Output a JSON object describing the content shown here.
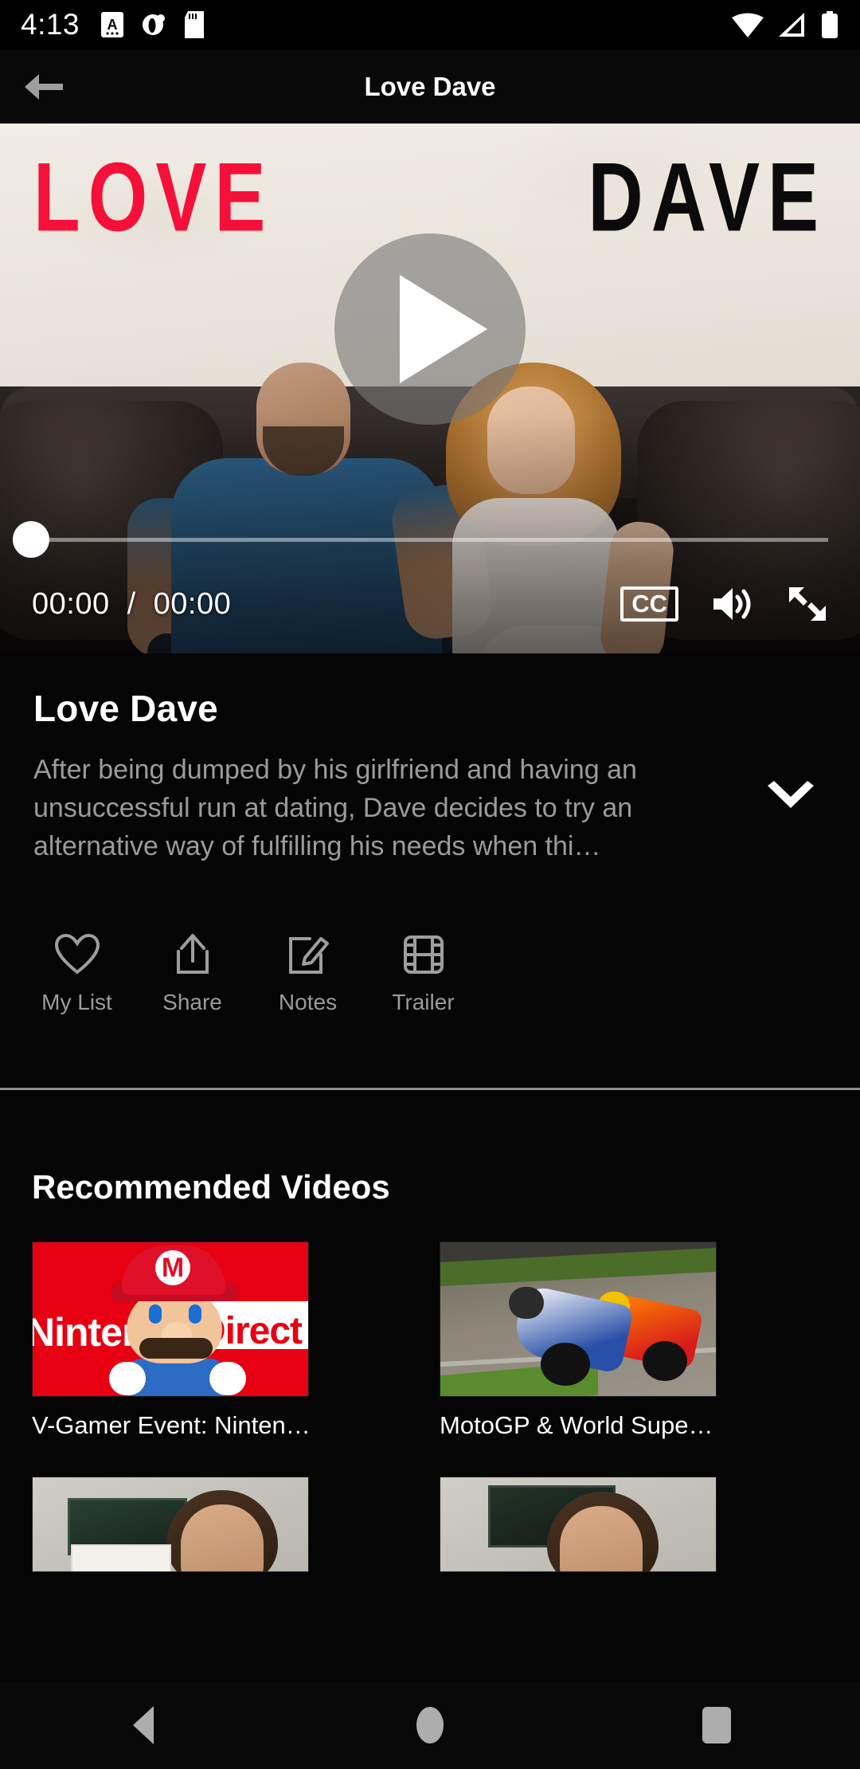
{
  "status_bar": {
    "time": "4:13",
    "left_icons": [
      "screenshot-a-icon",
      "app-badge-icon",
      "sd-card-icon"
    ],
    "right_icons": [
      "wifi-icon",
      "cellular-signal-icon",
      "battery-icon"
    ]
  },
  "app_bar": {
    "back_icon": "arrow-left-icon",
    "title": "Love Dave"
  },
  "player": {
    "poster_text_left": "LOVE",
    "poster_text_right": "DAVE",
    "poster_color_left": "#F5103A",
    "poster_color_right": "#0B0B0B",
    "poster_bg": "#EDE8E0",
    "play_icon": "play-icon",
    "current_time": "00:00",
    "time_separator": "/",
    "total_time": "00:00",
    "progress_percent": 0,
    "cc_label": "CC",
    "volume_icon": "volume-high-icon",
    "fullscreen_icon": "fullscreen-expand-icon"
  },
  "info": {
    "title": "Love Dave",
    "description": "After being dumped by his girlfriend and having an unsuccessful run at dating, Dave decides to try an alternative way of fulfilling his needs when thi…",
    "expand_icon": "chevron-down-icon",
    "actions": [
      {
        "label": "My List",
        "icon": "heart-icon"
      },
      {
        "label": "Share",
        "icon": "share-upload-icon"
      },
      {
        "label": "Notes",
        "icon": "edit-pencil-icon"
      },
      {
        "label": "Trailer",
        "icon": "film-strip-icon"
      }
    ]
  },
  "recommended": {
    "heading": "Recommended Videos",
    "items": [
      {
        "label": "V-Gamer Event: Nintendo Direct…",
        "thumb": "nintendo-direct-mario-thumbnail"
      },
      {
        "label": "MotoGP & World Superbike",
        "thumb": "motogp-racing-thumbnail"
      },
      {
        "label": "",
        "thumb": "woman-dollar-bill-thumbnail-1"
      },
      {
        "label": "",
        "thumb": "woman-dollar-bill-thumbnail-2"
      }
    ]
  },
  "nav_bar": {
    "back": "nav-back-icon",
    "home": "nav-home-icon",
    "recents": "nav-recents-icon"
  }
}
